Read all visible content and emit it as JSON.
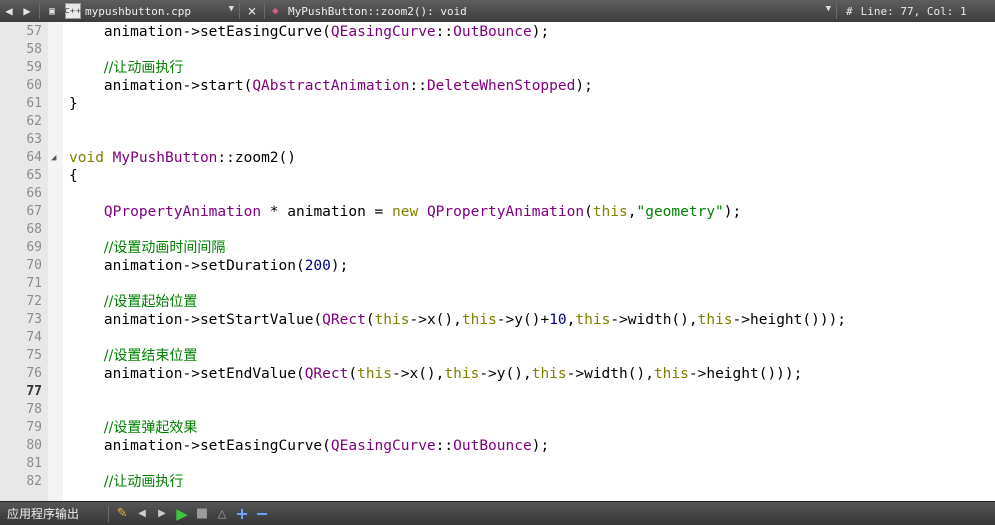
{
  "toolbar": {
    "back_icon": "arrow-left-icon",
    "forward_icon": "arrow-right-icon",
    "file_name": "mypushbutton.cpp",
    "file_icon_label": "C++",
    "close_icon": "×",
    "function_name": "MyPushButton::zoom2(): void",
    "line_col": "Line: 77, Col: 1",
    "hash": "#"
  },
  "editor": {
    "current_line": 77,
    "lines": [
      {
        "n": "57",
        "t": "    animation->setEasingCurve(QEasingCurve::OutBounce);"
      },
      {
        "n": "58",
        "t": ""
      },
      {
        "n": "59",
        "t": "    //让动画执行"
      },
      {
        "n": "60",
        "t": "    animation->start(QAbstractAnimation::DeleteWhenStopped);"
      },
      {
        "n": "61",
        "t": "}"
      },
      {
        "n": "62",
        "t": ""
      },
      {
        "n": "63",
        "t": ""
      },
      {
        "n": "64",
        "t": "void MyPushButton::zoom2()"
      },
      {
        "n": "65",
        "t": "{"
      },
      {
        "n": "66",
        "t": ""
      },
      {
        "n": "67",
        "t": "    QPropertyAnimation * animation = new QPropertyAnimation(this,\"geometry\");"
      },
      {
        "n": "68",
        "t": ""
      },
      {
        "n": "69",
        "t": "    //设置动画时间间隔"
      },
      {
        "n": "70",
        "t": "    animation->setDuration(200);"
      },
      {
        "n": "71",
        "t": ""
      },
      {
        "n": "72",
        "t": "    //设置起始位置"
      },
      {
        "n": "73",
        "t": "    animation->setStartValue(QRect(this->x(),this->y()+10,this->width(),this->height()));"
      },
      {
        "n": "74",
        "t": ""
      },
      {
        "n": "75",
        "t": "    //设置结束位置"
      },
      {
        "n": "76",
        "t": "    animation->setEndValue(QRect(this->x(),this->y(),this->width(),this->height()));"
      },
      {
        "n": "77",
        "t": ""
      },
      {
        "n": "78",
        "t": ""
      },
      {
        "n": "79",
        "t": "    //设置弹起效果"
      },
      {
        "n": "80",
        "t": "    animation->setEasingCurve(QEasingCurve::OutBounce);"
      },
      {
        "n": "81",
        "t": ""
      },
      {
        "n": "82",
        "t": "    //让动画执行"
      }
    ]
  },
  "bottombar": {
    "output_label": "应用程序输出",
    "icons": [
      "broom-icon",
      "prev-arrow-icon",
      "next-arrow-icon",
      "run-icon",
      "stop-icon",
      "attach-icon",
      "plus-icon",
      "minus-icon"
    ]
  }
}
